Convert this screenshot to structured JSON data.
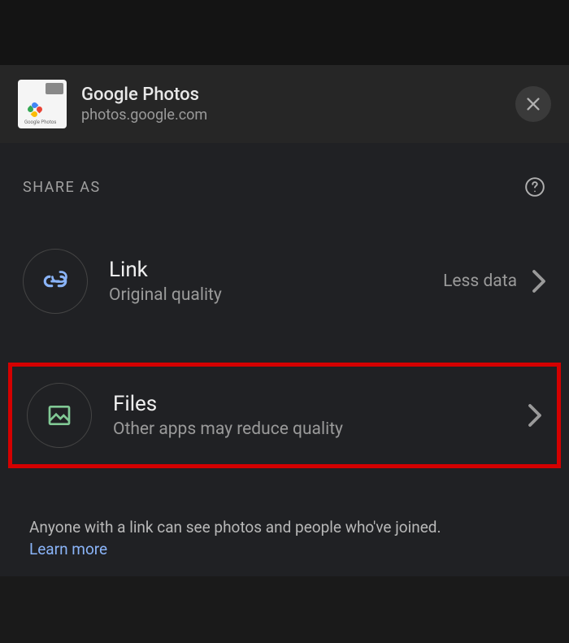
{
  "header": {
    "app_title": "Google Photos",
    "app_url": "photos.google.com",
    "thumb_label": "Google Photos"
  },
  "section": {
    "label": "SHARE AS"
  },
  "options": {
    "link": {
      "title": "Link",
      "subtitle": "Original quality",
      "meta": "Less data"
    },
    "files": {
      "title": "Files",
      "subtitle": "Other apps may reduce quality"
    }
  },
  "footer": {
    "disclaimer": "Anyone with a link can see photos and people who've joined.",
    "learn_more": "Learn more"
  },
  "colors": {
    "link_icon": "#8ab4f8",
    "files_icon": "#81c995",
    "highlight": "#d40000"
  }
}
